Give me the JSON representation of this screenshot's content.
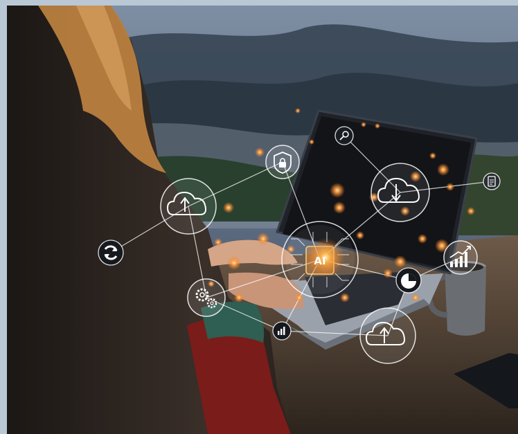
{
  "image": {
    "subject": "person-using-laptop-with-ai-network-overlay",
    "ai_chip_label": "AI",
    "network_icons": [
      "shield-lock-icon",
      "magnifier-icon",
      "cloud-download-icon",
      "document-icon",
      "cloud-upload-icon",
      "refresh-icon",
      "gear-icon",
      "bar-chart-icon",
      "pie-chart-icon",
      "growth-chart-icon",
      "small-bar-chart-icon",
      "cloud-upload-bottom-icon"
    ],
    "colors": {
      "sky": "#5d6e86",
      "mountains": "#2c3b4a",
      "sweater": "#2a221e",
      "hair": "#c98a47",
      "laptop": "#1f2228",
      "glow": "#ffb347",
      "icon_stroke": "#ffffff"
    }
  }
}
